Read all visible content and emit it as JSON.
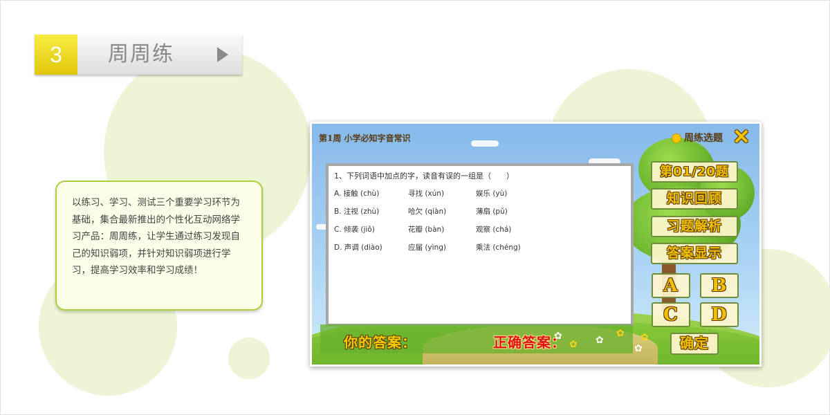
{
  "header": {
    "section_number": "3",
    "section_title": "周周练"
  },
  "description": "以练习、学习、测试三个重要学习环节为基础，集合最新推出的个性化互动网络学习产品：周周练，让学生通过练习发现自己的知识弱项，并针对知识弱项进行学习，提高学习效率和学习成绩！",
  "app": {
    "title": "第1周 小学必知字音常识",
    "week_select_label": "周练选题",
    "close_icon": "close-x-icon",
    "question": {
      "text": "1、下列词语中加点的字，读音有误的一组是（　　）",
      "options": [
        [
          "A. 接触 (chù)",
          "寻找 (xún)",
          "娱乐 (yù)"
        ],
        [
          "B. 注视 (zhù)",
          "哈欠 (qiàn)",
          "薄扇 (pǔ)"
        ],
        [
          "C. 倾袭 (jiǒ)",
          "花瓣 (bàn)",
          "观察 (chá)"
        ],
        [
          "D. 声调 (diào)",
          "应届 (yìng)",
          "乘法 (chéng)"
        ]
      ]
    },
    "side_buttons": {
      "progress": "第01/20题",
      "review": "知识回顾",
      "analysis": "习题解析",
      "show_answer": "答案显示"
    },
    "answer_buttons": [
      "A",
      "B",
      "C",
      "D"
    ],
    "confirm": "确定",
    "your_answer_label": "你的答案：",
    "correct_answer_label": "正确答案："
  },
  "colors": {
    "accent_yellow": "#f3c000",
    "tab_yellow": "#f7ec44",
    "card_border": "#a8d23c",
    "correct_red": "#e01414",
    "circle_bg": "#eef5d6"
  }
}
